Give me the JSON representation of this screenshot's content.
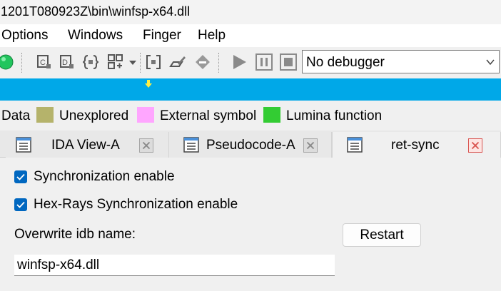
{
  "window": {
    "title": "1201T080923Z\\bin\\winfsp-x64.dll"
  },
  "menu": [
    "Options",
    "Windows",
    "Finger",
    "Help"
  ],
  "toolbar": {
    "icons": [
      "status-light-icon",
      "code-icon",
      "data-icon",
      "struct-icon",
      "enum-icon",
      "dropdown-arrow-icon",
      "undefine-icon",
      "rename-icon",
      "jump-icon",
      "run-icon",
      "pause-icon",
      "stop-icon"
    ],
    "debugger_value": "No debugger"
  },
  "legend": [
    {
      "label": "Data",
      "color": ""
    },
    {
      "label": "Unexplored",
      "color": "#b5b36b"
    },
    {
      "label": "External symbol",
      "color": "#ffa6ff"
    },
    {
      "label": "Lumina function",
      "color": "#33cc33"
    }
  ],
  "colors": {
    "nav_band": "#00a8e8",
    "status_light": "#22c55e",
    "checkbox": "#0067c0"
  },
  "tabs": [
    {
      "label": "IDA View-A",
      "active": false
    },
    {
      "label": "Pseudocode-A",
      "active": false
    },
    {
      "label": "ret-sync",
      "active": true
    }
  ],
  "panel": {
    "sync_enable_label": "Synchronization enable",
    "sync_enable_checked": true,
    "hexrays_sync_label": "Hex-Rays Synchronization enable",
    "hexrays_sync_checked": true,
    "overwrite_label": "Overwrite idb name:",
    "restart_label": "Restart",
    "idb_name_value": "winfsp-x64.dll"
  }
}
